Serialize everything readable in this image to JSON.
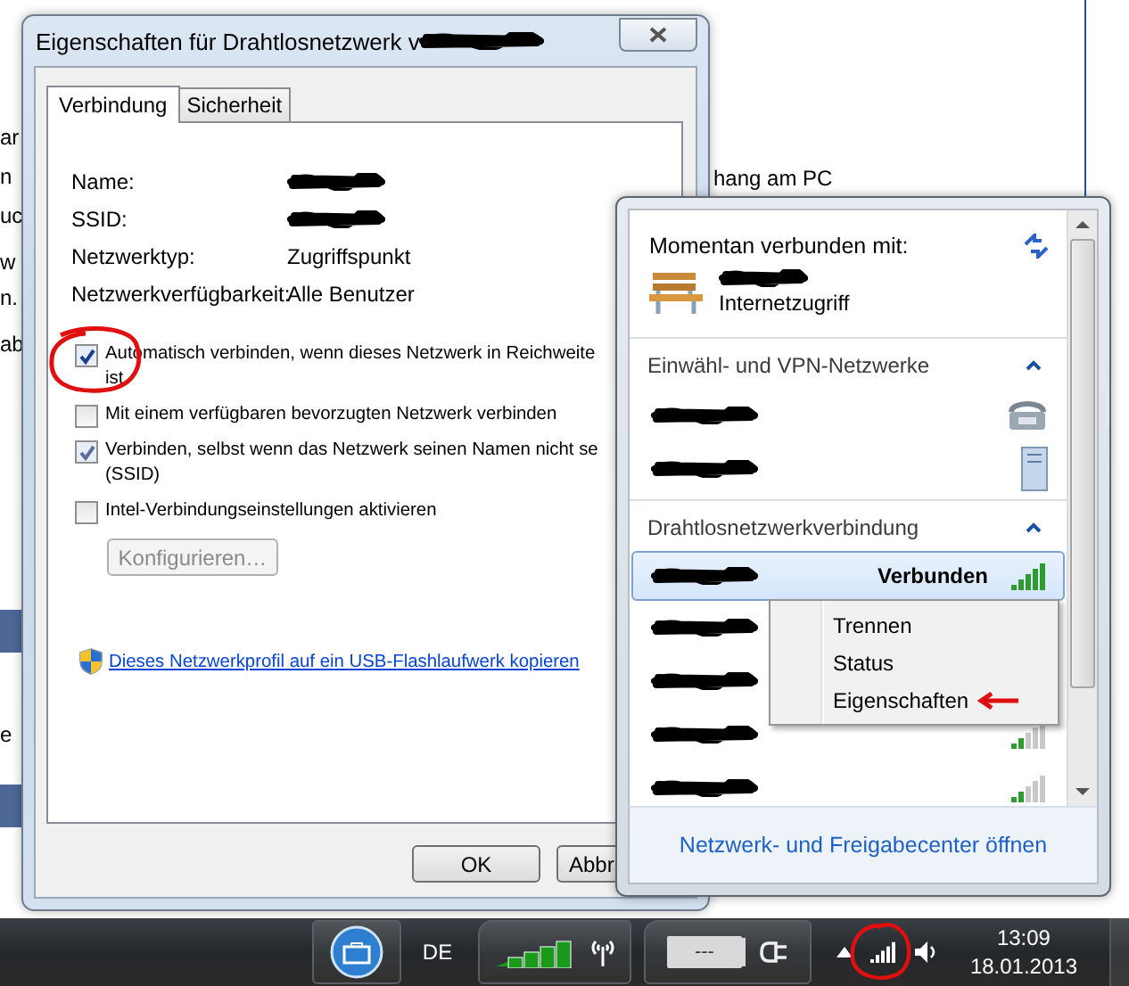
{
  "background": {
    "fragments": [
      "ar",
      "n",
      "uc",
      "w",
      "n.",
      "ab",
      "e"
    ],
    "note": "hang am PC"
  },
  "dialog": {
    "title": "Eigenschaften für Drahtlosnetzwerk v",
    "title_redacted": true,
    "tabs": [
      {
        "label": "Verbindung",
        "selected": true
      },
      {
        "label": "Sicherheit",
        "selected": false
      }
    ],
    "properties": [
      {
        "label": "Name:",
        "redacted": true
      },
      {
        "label": "SSID:",
        "redacted": true
      },
      {
        "label": "Netzwerktyp:",
        "value": "Zugriffspunkt"
      },
      {
        "label": "Netzwerkverfügbarkeit:",
        "value": "Alle Benutzer"
      }
    ],
    "options": [
      {
        "lines": [
          "Automatisch verbinden, wenn dieses Netzwerk in Reichweite",
          "ist"
        ],
        "checked": true,
        "circled": true
      },
      {
        "lines": [
          "Mit einem verfügbaren bevorzugten Netzwerk verbinden"
        ],
        "checked": false,
        "circled": false
      },
      {
        "lines": [
          "Verbinden, selbst wenn das Netzwerk seinen Namen nicht se",
          "(SSID)"
        ],
        "checked": true,
        "circled": false
      },
      {
        "lines": [
          "Intel-Verbindungseinstellungen aktivieren"
        ],
        "checked": false,
        "circled": false
      }
    ],
    "configure_button": {
      "label": "Konfigurieren…",
      "disabled": true
    },
    "link": "Dieses Netzwerkprofil auf ein USB-Flashlaufwerk kopieren",
    "buttons": [
      "OK",
      "Abbr"
    ]
  },
  "flyout": {
    "header": "Momentan verbunden mit:",
    "connection": {
      "name_redacted": true,
      "access": "Internetzugriff"
    },
    "sections": [
      {
        "title": "Einwähl- und VPN-Netzwerke",
        "expanded": true,
        "items": [
          {
            "kind": "dialup",
            "redacted": true,
            "selected": false
          },
          {
            "kind": "vpn",
            "redacted": true,
            "selected": false
          }
        ]
      },
      {
        "title": "Drahtlosnetzwerkverbindung",
        "expanded": true,
        "items": [
          {
            "kind": "wifi",
            "redacted": true,
            "selected": true,
            "status": "Verbunden",
            "strong_signal": true
          },
          {
            "kind": "wifi",
            "redacted": true,
            "selected": false
          },
          {
            "kind": "wifi",
            "redacted": true,
            "selected": false
          },
          {
            "kind": "wifi",
            "redacted": true,
            "selected": false,
            "strong_signal": false
          },
          {
            "kind": "wifi",
            "redacted": true,
            "selected": false,
            "strong_signal": false
          }
        ]
      }
    ],
    "footer_link": "Netzwerk- und Freigabecenter öffnen"
  },
  "context_menu": {
    "items": [
      {
        "label": "Trennen",
        "pointed": false
      },
      {
        "label": "Status",
        "pointed": false
      },
      {
        "label": "Eigenschaften",
        "pointed": true
      }
    ]
  },
  "taskbar": {
    "language": "DE",
    "battery": "---",
    "time": "13:09",
    "date": "18.01.2013",
    "tray_signal_circled": true
  }
}
